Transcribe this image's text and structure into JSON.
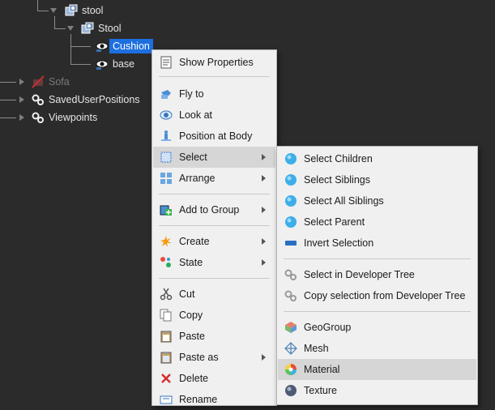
{
  "tree": {
    "nodes": [
      {
        "label": "stool"
      },
      {
        "label": "Stool"
      },
      {
        "label": "Cushion"
      },
      {
        "label": "base"
      },
      {
        "label": "Sofa"
      },
      {
        "label": "SavedUserPositions"
      },
      {
        "label": "Viewpoints"
      }
    ]
  },
  "context_menu": {
    "items": [
      {
        "label": "Show Properties",
        "icon": "properties-icon"
      },
      {
        "label": "Fly to",
        "icon": "fly-to-icon"
      },
      {
        "label": "Look at",
        "icon": "look-at-icon"
      },
      {
        "label": "Position at Body",
        "icon": "position-at-body-icon"
      },
      {
        "label": "Select",
        "icon": "select-icon",
        "submenu": true
      },
      {
        "label": "Arrange",
        "icon": "arrange-icon",
        "submenu": true
      },
      {
        "label": "Add to Group",
        "icon": "add-to-group-icon",
        "submenu": true
      },
      {
        "label": "Create",
        "icon": "create-icon",
        "submenu": true
      },
      {
        "label": "State",
        "icon": "state-icon",
        "submenu": true
      },
      {
        "label": "Cut",
        "icon": "cut-icon"
      },
      {
        "label": "Copy",
        "icon": "copy-icon"
      },
      {
        "label": "Paste",
        "icon": "paste-icon"
      },
      {
        "label": "Paste as",
        "icon": "paste-as-icon",
        "submenu": true
      },
      {
        "label": "Delete",
        "icon": "delete-icon"
      },
      {
        "label": "Rename",
        "icon": "rename-icon"
      }
    ]
  },
  "select_submenu": {
    "items": [
      {
        "label": "Select Children",
        "icon": "globe-icon"
      },
      {
        "label": "Select Siblings",
        "icon": "globe-icon"
      },
      {
        "label": "Select All Siblings",
        "icon": "globe-icon"
      },
      {
        "label": "Select Parent",
        "icon": "globe-icon"
      },
      {
        "label": "Invert Selection",
        "icon": "invert-selection-icon"
      },
      {
        "label": "Select in Developer Tree",
        "icon": "gears-icon"
      },
      {
        "label": "Copy selection from Developer Tree",
        "icon": "gears-icon"
      },
      {
        "label": "GeoGroup",
        "icon": "geogroup-icon"
      },
      {
        "label": "Mesh",
        "icon": "mesh-icon"
      },
      {
        "label": "Material",
        "icon": "material-icon"
      },
      {
        "label": "Texture",
        "icon": "texture-icon"
      }
    ]
  },
  "colors": {
    "selection": "#1d6fe0",
    "menu_bg": "#f0f0f0",
    "menu_highlight": "#d6d6d6",
    "tree_bg": "#2b2b2b"
  }
}
